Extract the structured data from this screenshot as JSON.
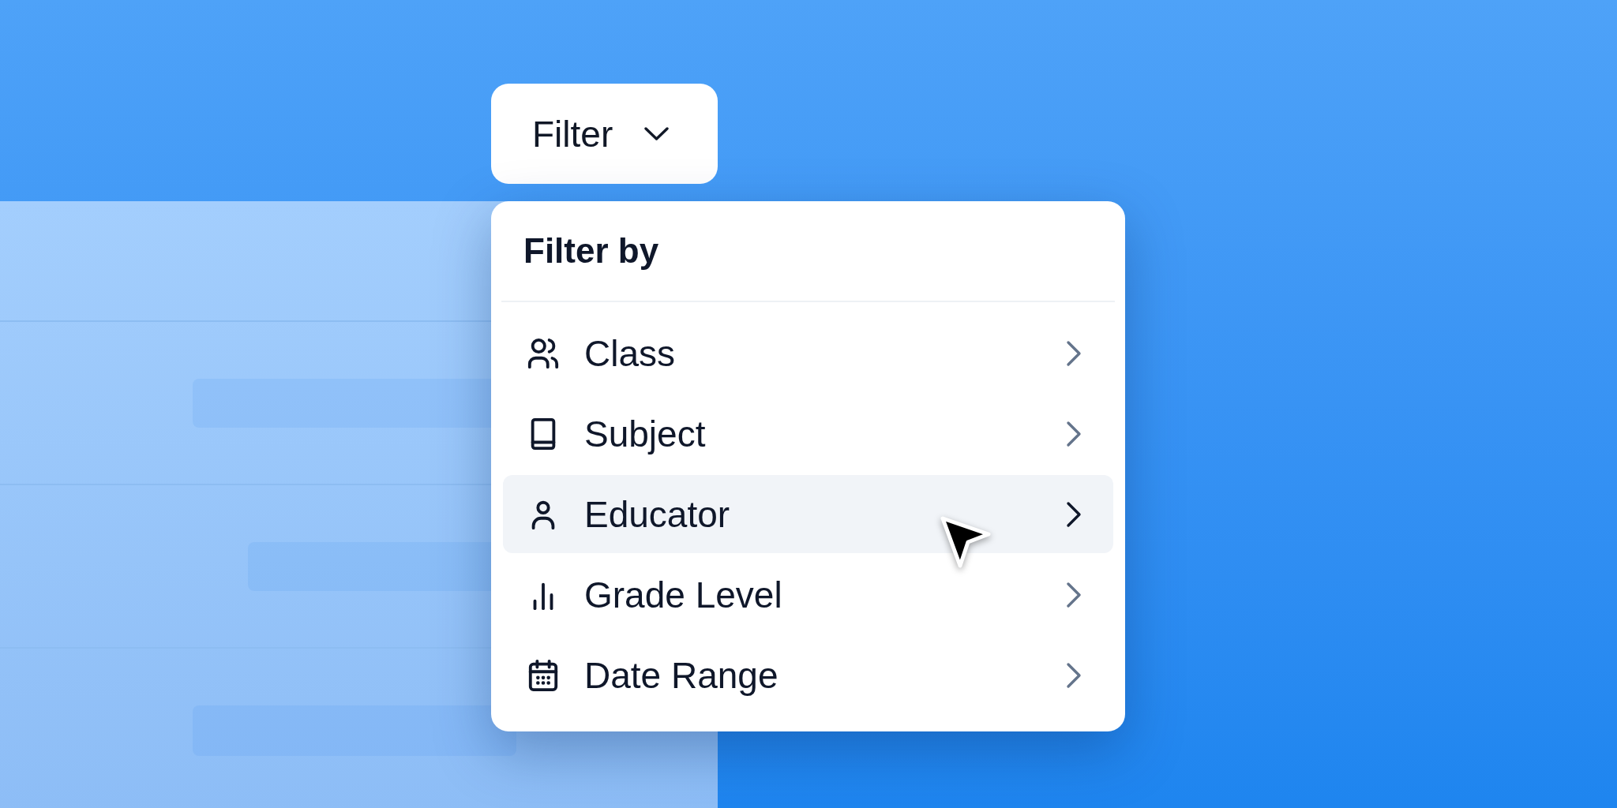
{
  "filter_button": {
    "label": "Filter"
  },
  "filter_menu": {
    "title": "Filter by",
    "items": [
      {
        "label": "Class",
        "selected": false
      },
      {
        "label": "Subject",
        "selected": false
      },
      {
        "label": "Educator",
        "selected": true
      },
      {
        "label": "Grade Level",
        "selected": false
      },
      {
        "label": "Date Range",
        "selected": false
      }
    ]
  }
}
